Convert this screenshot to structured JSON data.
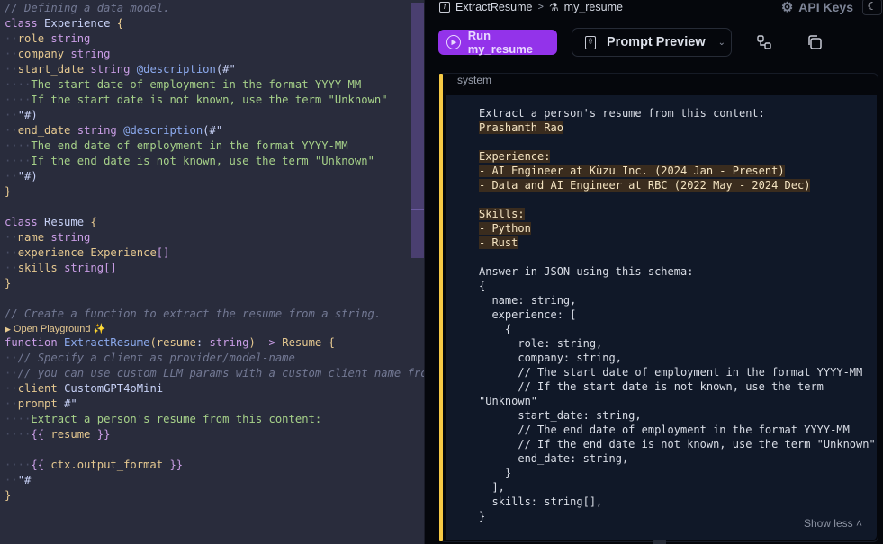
{
  "editor": {
    "lines": [
      [
        {
          "t": "// Defining a data model.",
          "c": "c-comment"
        }
      ],
      [
        {
          "t": "class ",
          "c": "c-kw"
        },
        {
          "t": "Experience ",
          "c": "c-type"
        },
        {
          "t": "{",
          "c": "c-brace"
        }
      ],
      [
        {
          "t": "··",
          "c": "guide"
        },
        {
          "t": "role ",
          "c": "c-var"
        },
        {
          "t": "string",
          "c": "c-kw"
        }
      ],
      [
        {
          "t": "··",
          "c": "guide"
        },
        {
          "t": "company ",
          "c": "c-var"
        },
        {
          "t": "string",
          "c": "c-kw"
        }
      ],
      [
        {
          "t": "··",
          "c": "guide"
        },
        {
          "t": "start_date ",
          "c": "c-var"
        },
        {
          "t": "string ",
          "c": "c-kw"
        },
        {
          "t": "@description",
          "c": "c-attr"
        },
        {
          "t": "(#\"",
          "c": "c-punct"
        }
      ],
      [
        {
          "t": "····",
          "c": "guide"
        },
        {
          "t": "The start date of employment in the format YYYY-MM",
          "c": "c-str"
        }
      ],
      [
        {
          "t": "····",
          "c": "guide"
        },
        {
          "t": "If the start date is not known, use the term \"Unknown\"",
          "c": "c-str"
        }
      ],
      [
        {
          "t": "··",
          "c": "guide"
        },
        {
          "t": "\"#)",
          "c": "c-punct"
        }
      ],
      [
        {
          "t": "··",
          "c": "guide"
        },
        {
          "t": "end_date ",
          "c": "c-var"
        },
        {
          "t": "string ",
          "c": "c-kw"
        },
        {
          "t": "@description",
          "c": "c-attr"
        },
        {
          "t": "(#\"",
          "c": "c-punct"
        }
      ],
      [
        {
          "t": "····",
          "c": "guide"
        },
        {
          "t": "The end date of employment in the format YYYY-MM",
          "c": "c-str"
        }
      ],
      [
        {
          "t": "····",
          "c": "guide"
        },
        {
          "t": "If the end date is not known, use the term \"Unknown\"",
          "c": "c-str"
        }
      ],
      [
        {
          "t": "··",
          "c": "guide"
        },
        {
          "t": "\"#)",
          "c": "c-punct"
        }
      ],
      [
        {
          "t": "}",
          "c": "c-brace"
        }
      ],
      [],
      [
        {
          "t": "class ",
          "c": "c-kw"
        },
        {
          "t": "Resume ",
          "c": "c-type"
        },
        {
          "t": "{",
          "c": "c-brace"
        }
      ],
      [
        {
          "t": "··",
          "c": "guide"
        },
        {
          "t": "name ",
          "c": "c-var"
        },
        {
          "t": "string",
          "c": "c-kw"
        }
      ],
      [
        {
          "t": "··",
          "c": "guide"
        },
        {
          "t": "experience ",
          "c": "c-var"
        },
        {
          "t": "Experience",
          "c": "c-var"
        },
        {
          "t": "[]",
          "c": "c-kw"
        }
      ],
      [
        {
          "t": "··",
          "c": "guide"
        },
        {
          "t": "skills ",
          "c": "c-var"
        },
        {
          "t": "string",
          "c": "c-kw"
        },
        {
          "t": "[]",
          "c": "c-kw"
        }
      ],
      [
        {
          "t": "}",
          "c": "c-brace"
        }
      ],
      [],
      [
        {
          "t": "// Create a function to extract the resume from a string.",
          "c": "c-comment"
        }
      ],
      "PLAYGROUND",
      [
        {
          "t": "function ",
          "c": "c-kw"
        },
        {
          "t": "ExtractResume",
          "c": "c-func"
        },
        {
          "t": "(",
          "c": "c-brace"
        },
        {
          "t": "resume",
          "c": "c-var"
        },
        {
          "t": ": ",
          "c": "c-punct"
        },
        {
          "t": "string",
          "c": "c-kw"
        },
        {
          "t": ") ",
          "c": "c-brace"
        },
        {
          "t": "-> ",
          "c": "c-kw"
        },
        {
          "t": "Resume ",
          "c": "c-var"
        },
        {
          "t": "{",
          "c": "c-brace"
        }
      ],
      [
        {
          "t": "··",
          "c": "guide"
        },
        {
          "t": "// Specify a client as provider/model-name",
          "c": "c-comment"
        }
      ],
      [
        {
          "t": "··",
          "c": "guide"
        },
        {
          "t": "// you can use custom LLM params with a custom client name from",
          "c": "c-comment"
        }
      ],
      [
        {
          "t": "··",
          "c": "guide"
        },
        {
          "t": "client ",
          "c": "c-var"
        },
        {
          "t": "CustomGPT4oMini",
          "c": "c-type"
        }
      ],
      [
        {
          "t": "··",
          "c": "guide"
        },
        {
          "t": "prompt ",
          "c": "c-var"
        },
        {
          "t": "#\"",
          "c": "c-punct"
        }
      ],
      [
        {
          "t": "····",
          "c": "guide"
        },
        {
          "t": "Extract a person's resume from this content:",
          "c": "c-str"
        }
      ],
      [
        {
          "t": "····",
          "c": "guide"
        },
        {
          "t": "{{ ",
          "c": "c-tmpl"
        },
        {
          "t": "resume",
          "c": "c-var"
        },
        {
          "t": " }}",
          "c": "c-tmpl"
        }
      ],
      [],
      [
        {
          "t": "····",
          "c": "guide"
        },
        {
          "t": "{{ ",
          "c": "c-tmpl"
        },
        {
          "t": "ctx.output_format",
          "c": "c-var"
        },
        {
          "t": " }}",
          "c": "c-tmpl"
        }
      ],
      [
        {
          "t": "··",
          "c": "guide"
        },
        {
          "t": "\"#",
          "c": "c-punct"
        }
      ],
      [
        {
          "t": "}",
          "c": "c-brace"
        }
      ]
    ],
    "playground_label": "Open Playground",
    "playground_icon": "sparkles-icon"
  },
  "header": {
    "function_name": "ExtractResume",
    "test_name": "my_resume",
    "api_keys_label": "API Keys"
  },
  "toolbar": {
    "run_label": "Run my_resume",
    "view_label": "Prompt Preview"
  },
  "message": {
    "role": "system",
    "lines": [
      {
        "t": "Extract a person's resume from this content:",
        "hl": false
      },
      {
        "t": "Prashanth Rao",
        "hl": true
      },
      {
        "t": "",
        "hl": false
      },
      {
        "t": "Experience:",
        "hl": true
      },
      {
        "t": "- AI Engineer at Kùzu Inc. (2024 Jan - Present)",
        "hl": true
      },
      {
        "t": "- Data and AI Engineer at RBC (2022 May - 2024 Dec)",
        "hl": true
      },
      {
        "t": "",
        "hl": false
      },
      {
        "t": "Skills:",
        "hl": true
      },
      {
        "t": "- Python",
        "hl": true
      },
      {
        "t": "- Rust",
        "hl": true
      },
      {
        "t": "",
        "hl": false
      },
      {
        "t": "Answer in JSON using this schema:",
        "hl": false
      },
      {
        "t": "{",
        "hl": false
      },
      {
        "t": "  name: string,",
        "hl": false
      },
      {
        "t": "  experience: [",
        "hl": false
      },
      {
        "t": "    {",
        "hl": false
      },
      {
        "t": "      role: string,",
        "hl": false
      },
      {
        "t": "      company: string,",
        "hl": false
      },
      {
        "t": "      // The start date of employment in the format YYYY-MM",
        "hl": false
      },
      {
        "t": "      // If the start date is not known, use the term",
        "hl": false
      },
      {
        "t": "\"Unknown\"",
        "hl": false
      },
      {
        "t": "      start_date: string,",
        "hl": false
      },
      {
        "t": "      // The end date of employment in the format YYYY-MM",
        "hl": false
      },
      {
        "t": "      // If the end date is not known, use the term \"Unknown\"",
        "hl": false
      },
      {
        "t": "      end_date: string,",
        "hl": false
      },
      {
        "t": "    }",
        "hl": false
      },
      {
        "t": "  ],",
        "hl": false
      },
      {
        "t": "  skills: string[],",
        "hl": false
      },
      {
        "t": "}",
        "hl": false
      }
    ],
    "show_less_label": "Show less"
  },
  "colors": {
    "accent": "#9333ea",
    "message_bar": "#f6c945",
    "editor_bg": "#292c3c",
    "panel_bg": "#05070c"
  }
}
